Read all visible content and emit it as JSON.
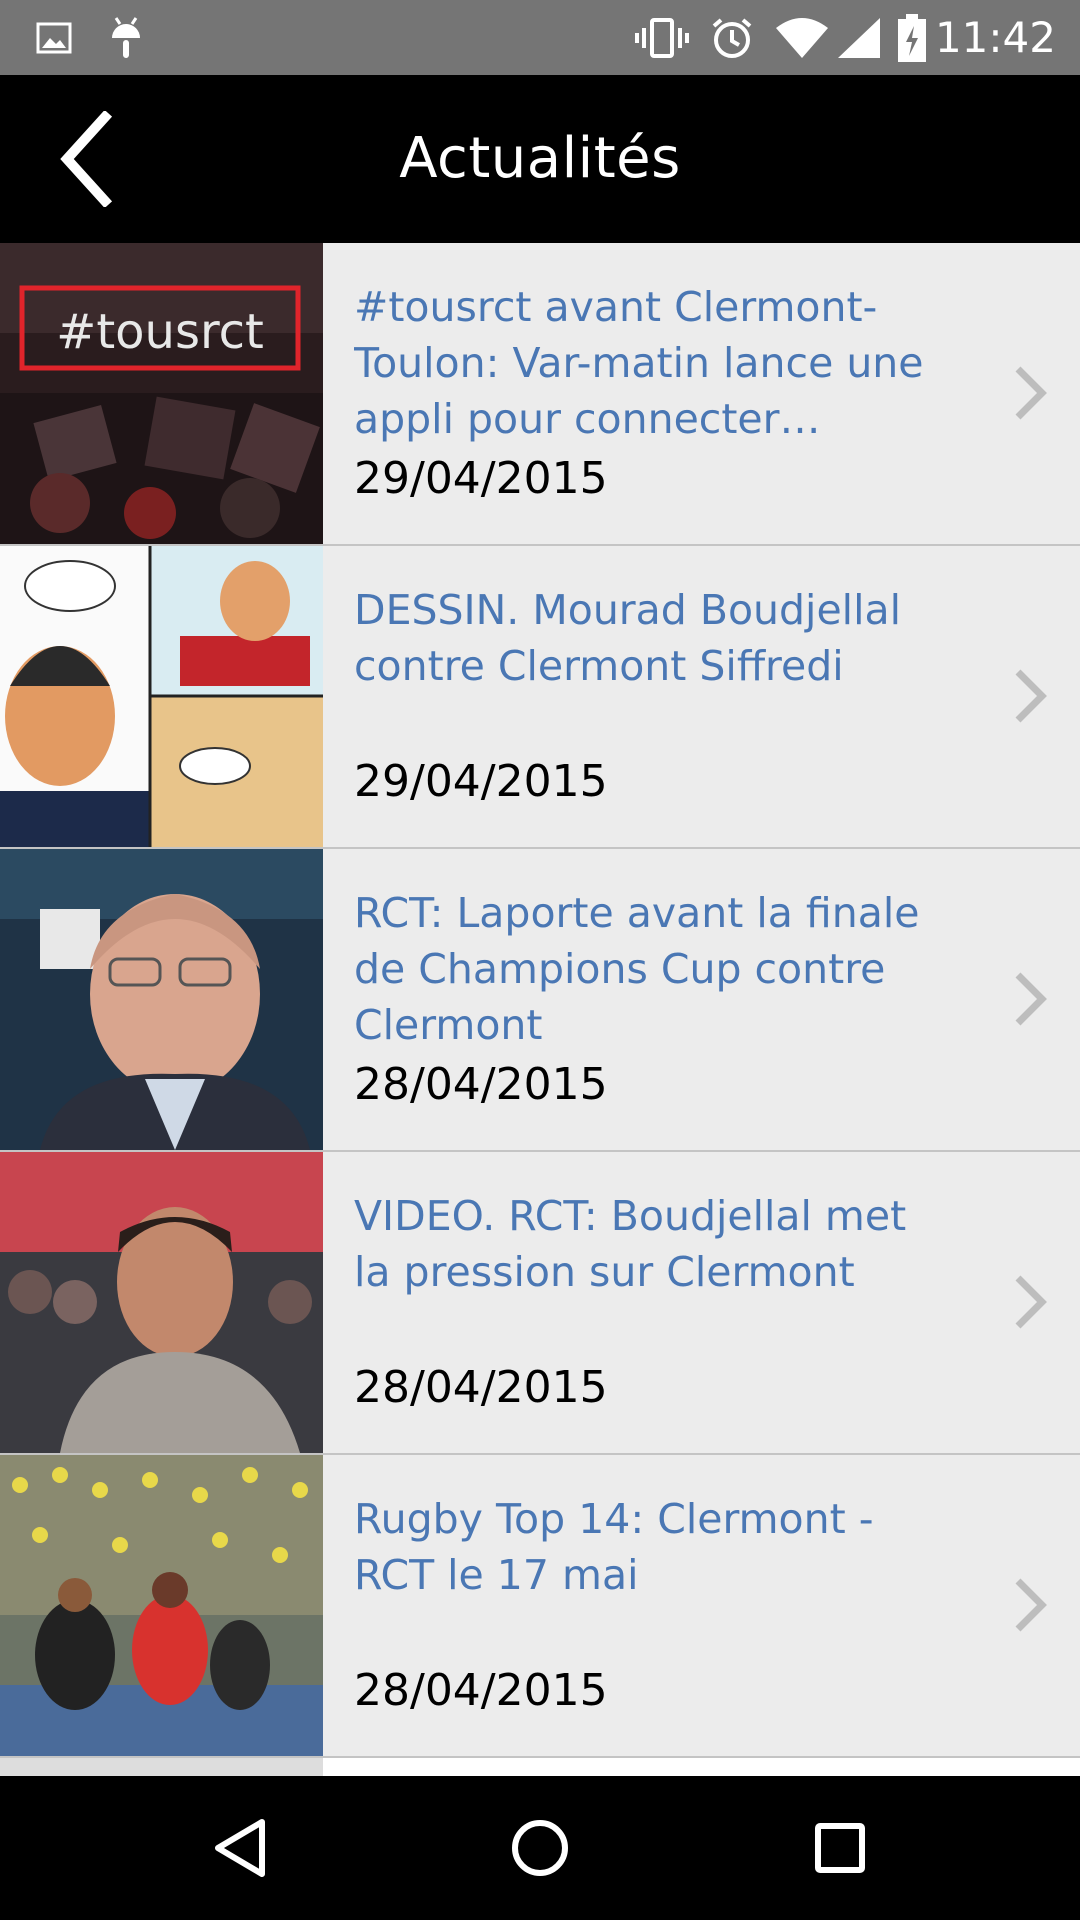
{
  "status_bar": {
    "time": "11:42",
    "left_icons": [
      "image-icon",
      "android-icon"
    ],
    "right_icons": [
      "vibrate-icon",
      "alarm-icon",
      "wifi-icon",
      "signal-icon",
      "battery-charging-icon"
    ]
  },
  "app_bar": {
    "title": "Actualités",
    "back_icon": "chevron-left-icon"
  },
  "colors": {
    "title_link": "#4a77b4",
    "list_background": "#ececec",
    "app_bar": "#000000",
    "status_bar": "#757575"
  },
  "news": [
    {
      "title": "#tousrct avant Clermont-Toulon: Var-matin lance une appli pour connecter…",
      "date": "29/04/2015",
      "thumb_overlay": "#tousrct"
    },
    {
      "title": "DESSIN. Mourad Boudjellal contre Clermont Siffredi",
      "date": "29/04/2015"
    },
    {
      "title": "RCT: Laporte avant la finale de Champions Cup contre Clermont",
      "date": "28/04/2015"
    },
    {
      "title": "VIDEO. RCT: Boudjellal met la pression sur Clermont",
      "date": "28/04/2015"
    },
    {
      "title": "Rugby Top 14: Clermont - RCT le 17 mai",
      "date": "28/04/2015"
    }
  ],
  "nav_bar": {
    "buttons": [
      "back-triangle-icon",
      "home-circle-icon",
      "recents-square-icon"
    ]
  }
}
